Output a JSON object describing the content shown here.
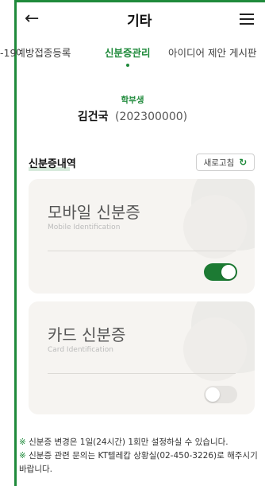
{
  "header": {
    "back_icon": "arrow-left-icon",
    "title": "기타",
    "menu_icon": "hamburger-menu-icon"
  },
  "tabs": [
    {
      "label": "-19예방접종등록"
    },
    {
      "label": "신분증관리",
      "active": true
    },
    {
      "label": "아이디어 제안 게시판"
    }
  ],
  "profile": {
    "role": "학부생",
    "name": "김건국",
    "student_id": "(202300000)"
  },
  "section": {
    "title": "신분증내역",
    "refresh_label": "새로고침",
    "refresh_icon": "refresh-icon"
  },
  "cards": [
    {
      "title": "모바일 신분증",
      "subtitle": "Mobile Identification",
      "enabled": true
    },
    {
      "title": "카드 신분증",
      "subtitle": "Card Identification",
      "enabled": false
    }
  ],
  "notes": [
    {
      "mark": "※",
      "text": " 신분증 변경은 1일(24시간) 1회만 설정하실 수 있습니다."
    },
    {
      "mark": "※",
      "text": " 신분증 관련 문의는 KT텔레캅 상황실(02-450-3226)로 해주시기 바랍니다."
    }
  ],
  "colors": {
    "accent": "#1f8a3b",
    "toggle_on": "#1c7a33",
    "card_bg": "#f6f4f1"
  }
}
